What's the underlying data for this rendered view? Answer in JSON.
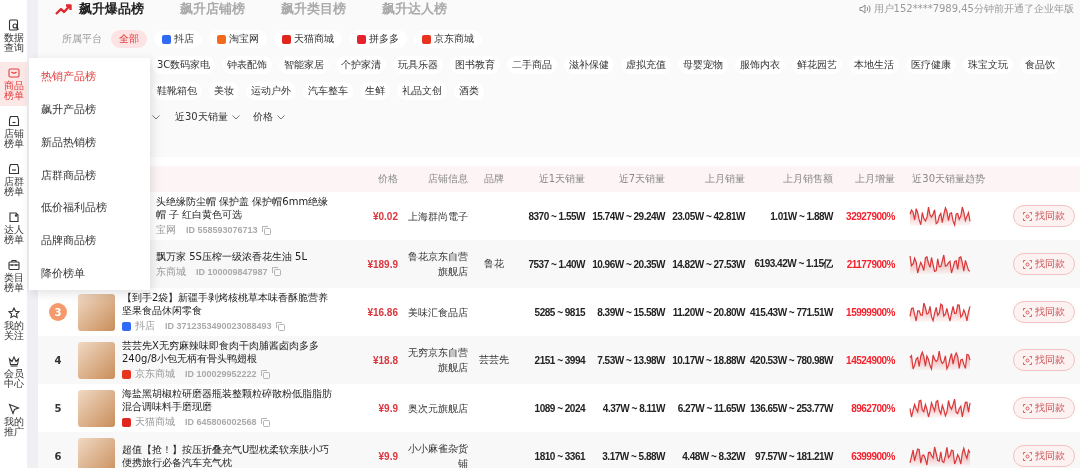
{
  "sidebar": {
    "items": [
      {
        "label": "数据查询",
        "selected": false
      },
      {
        "label": "商品榜单",
        "selected": true
      },
      {
        "label": "店铺榜单",
        "selected": false
      },
      {
        "label": "店群榜单",
        "selected": false
      },
      {
        "label": "达人榜单",
        "selected": false
      },
      {
        "label": "类目榜单",
        "selected": false
      },
      {
        "label": "我的关注",
        "selected": false
      },
      {
        "label": "会员中心",
        "selected": false
      },
      {
        "label": "我的推广",
        "selected": false
      }
    ]
  },
  "tabs": [
    {
      "label": "飙升爆品榜",
      "selected": true
    },
    {
      "label": "飙升店铺榜",
      "selected": false
    },
    {
      "label": "飙升类目榜",
      "selected": false
    },
    {
      "label": "飙升达人榜",
      "selected": false
    }
  ],
  "notice": "用户152****7989,45分钟前开通了企业年版",
  "platform_filter": {
    "label": "所属平台",
    "options": [
      {
        "label": "全部",
        "selected": true
      },
      {
        "label": "抖店",
        "selected": false,
        "color": "#2f6bf5"
      },
      {
        "label": "淘宝网",
        "selected": false,
        "color": "#f26a1b"
      },
      {
        "label": "天猫商城",
        "selected": false,
        "color": "#e0261e"
      },
      {
        "label": "拼多多",
        "selected": false,
        "color": "#e5222d"
      },
      {
        "label": "京东商城",
        "selected": false,
        "color": "#e8341f"
      }
    ]
  },
  "category_rows": [
    [
      "3C数码家电",
      "钟表配饰",
      "智能家居",
      "个护家清",
      "玩具乐器",
      "图书教育",
      "二手商品",
      "滋补保健",
      "虚拟充值",
      "母婴宠物",
      "服饰内衣",
      "鲜花园艺",
      "本地生活",
      "医疗健康",
      "珠宝文玩",
      "食品饮"
    ],
    [
      "鞋靴箱包",
      "美妆",
      "运动户外",
      "汽车整车",
      "生鲜",
      "礼品文创",
      "酒类"
    ]
  ],
  "sort_dropdowns": [
    {
      "label": "近30天销量"
    },
    {
      "label": "价格"
    }
  ],
  "menu": {
    "items": [
      {
        "label": "热销产品榜",
        "selected": true
      },
      {
        "label": "飙升产品榜",
        "selected": false
      },
      {
        "label": "新品热销榜",
        "selected": false
      },
      {
        "label": "店群商品榜",
        "selected": false
      },
      {
        "label": "低价福利品榜",
        "selected": false
      },
      {
        "label": "品牌商品榜",
        "selected": false
      },
      {
        "label": "降价榜单",
        "selected": false
      }
    ]
  },
  "table": {
    "columns": [
      "价格",
      "店铺信息",
      "品牌",
      "近1天销量",
      "近7天销量",
      "上月销量",
      "上月销售额",
      "上月增量",
      "近30天销量趋势"
    ],
    "rows": [
      {
        "title": "头绝缘防尘帽 保护盖 保护帽6mm绝缘帽 子 红白黄色可选",
        "platform": "宝网",
        "product_id": "ID 558593076713",
        "price": "¥0.02",
        "store": "上海群尚電子",
        "day1": "8370 ~ 1.55W",
        "day7": "15.74W ~ 29.24W",
        "last_month": "23.05W ~ 42.81W",
        "last_month_sales": "1.01W ~ 1.88W",
        "growth": "32927900%",
        "action": "找同款"
      },
      {
        "title": "飘万家 5S压榨一级浓香花生油 5L",
        "platform": "东商城",
        "product_id": "ID 100009847987",
        "price": "¥189.9",
        "store": "鲁花京东自营旗舰店",
        "brand": "鲁花",
        "day1": "7537 ~ 1.40W",
        "day7": "10.96W ~ 20.35W",
        "last_month": "14.82W ~ 27.53W",
        "last_month_sales": "6193.42W ~ 1.15亿",
        "growth": "21177900%",
        "action": "找同款"
      },
      {
        "rank": "3",
        "highlighted": true,
        "title": "【到手2袋】新疆手剥烤核桃草本味香酥脆营养坚果食品休闲零食",
        "platform": "抖店",
        "platform_logo": {
          "color": "#2f6bf5"
        },
        "product_id": "ID 3712353490023088493",
        "price": "¥16.86",
        "store": "美味汇食品店",
        "day1": "5285 ~ 9815",
        "day7": "8.39W ~ 15.58W",
        "last_month": "11.20W ~ 20.80W",
        "last_month_sales": "415.43W ~ 771.51W",
        "growth": "15999900%",
        "action": "找同款"
      },
      {
        "rank": "4",
        "highlighted": false,
        "title": "芸芸先X无穷麻辣味即食肉干肉脯酱卤肉多多240g/8小包无柄有骨头鸭翅根",
        "platform": "京东商城",
        "platform_logo": {
          "color": "#e8341f"
        },
        "product_id": "ID 100029952222",
        "price": "¥18.8",
        "store": "无穷京东自营旗舰店",
        "brand": "芸芸先",
        "day1": "2151 ~ 3994",
        "day7": "7.53W ~ 13.98W",
        "last_month": "10.17W ~ 18.88W",
        "last_month_sales": "420.53W ~ 780.98W",
        "growth": "14524900%",
        "action": "找同款"
      },
      {
        "rank": "5",
        "highlighted": false,
        "title": "海盐黑胡椒粒研磨器瓶装整颗粒碎散粉低脂脂肪混合调味料手磨现磨",
        "platform": "天猫商城",
        "platform_logo": {
          "color": "#e0261e"
        },
        "product_id": "ID 645806002568",
        "price": "¥9.9",
        "store": "奥次元旗舰店",
        "day1": "1089 ~ 2024",
        "day7": "4.37W ~ 8.11W",
        "last_month": "6.27W ~ 11.65W",
        "last_month_sales": "136.65W ~ 253.77W",
        "growth": "8962700%",
        "action": "找同款"
      },
      {
        "rank": "6",
        "highlighted": false,
        "title": "超值【抢！】按压折叠充气U型枕柔软亲肤小巧便携旅行必备汽车充气枕",
        "price": "¥9.9",
        "store": "小小麻雀杂货铺",
        "day1": "1810 ~ 3361",
        "day7": "3.17W ~ 5.88W",
        "last_month": "4.48W ~ 8.32W",
        "last_month_sales": "97.57W ~ 181.21W",
        "growth": "6399900%",
        "action": "找同款"
      }
    ]
  }
}
